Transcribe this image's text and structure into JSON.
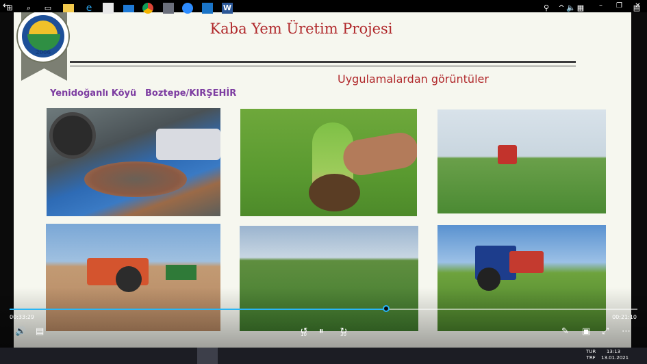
{
  "window": {
    "back_glyph": "←",
    "min_glyph": "–",
    "max_glyph": "❐",
    "close_glyph": "✕"
  },
  "slide": {
    "title": "Kaba Yem Üretim Projesi",
    "subtitle": "Uygulamalardan görüntüler",
    "location_village": "Yenidoğanlı Köyü",
    "location_town": "Boztepe/KIRŞEHİR",
    "logo_year": "2006",
    "logo_text": "KIRŞEHİR AHİ EVRAN ÜNİVERSİTESİ"
  },
  "player": {
    "elapsed": "00:33:29",
    "remaining": "00:21:10",
    "progress_fraction": 0.6,
    "volume_glyph": "🔊",
    "captions_glyph": "▤",
    "rewind_label": "10",
    "pause_glyph": "⏸",
    "forward_label": "30",
    "pen_glyph": "✎",
    "miniview_glyph": "▣",
    "fullscreen_glyph": "⤢",
    "more_glyph": "⋯",
    "accent_color": "#29b6f6"
  },
  "taskbar": {
    "start_glyph": "⊞",
    "search_glyph": "⌕",
    "taskview_glyph": "▭",
    "apps": [
      "file-explorer",
      "edge",
      "store",
      "mail",
      "chrome",
      "calculator",
      "zoom",
      "movies-tv",
      "word"
    ],
    "tray_people_glyph": "⚲",
    "tray_chevron": "^",
    "tray_volume": "🔈",
    "tray_network": "▦",
    "lang_line1": "TUR",
    "lang_line2": "TRF",
    "time": "13:13",
    "date": "13.01.2021",
    "notification_glyph": "▤"
  }
}
